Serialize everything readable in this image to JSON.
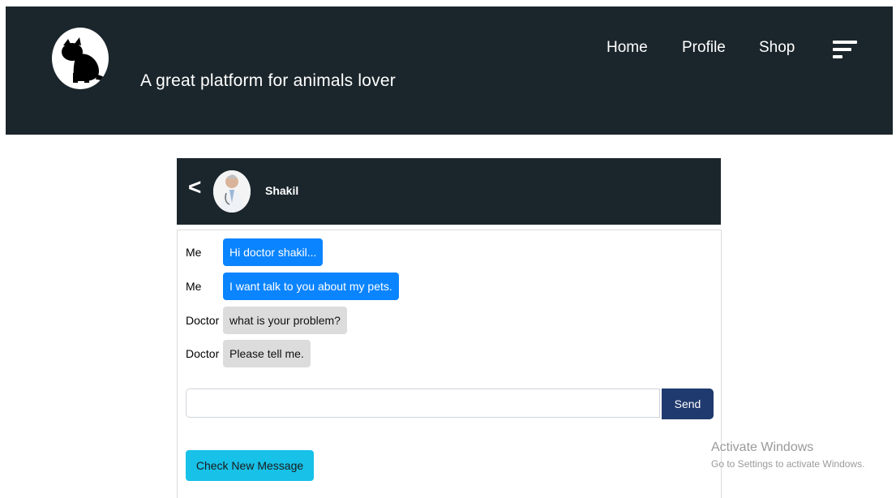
{
  "header": {
    "tagline": "A great platform for animals lover",
    "nav": [
      {
        "label": "Home"
      },
      {
        "label": "Profile"
      },
      {
        "label": "Shop"
      }
    ]
  },
  "chat": {
    "back": "<",
    "contact_name": "Shakil",
    "messages": [
      {
        "sender": "Me",
        "text": "Hi doctor shakil...",
        "type": "me"
      },
      {
        "sender": "Me",
        "text": "I want talk to you about my pets.",
        "type": "me"
      },
      {
        "sender": "Doctor",
        "text": "what is your problem?",
        "type": "doctor"
      },
      {
        "sender": "Doctor",
        "text": "Please tell me.",
        "type": "doctor"
      }
    ],
    "input_value": "",
    "send_label": "Send",
    "check_label": "Check New Message"
  },
  "watermark": {
    "title": "Activate Windows",
    "subtitle": "Go to Settings to activate Windows."
  },
  "colors": {
    "navbar": "#1b262c",
    "me_bubble": "#0a84ff",
    "doctor_bubble": "#dcdcdc",
    "send_button": "#1f3a6e",
    "check_button": "#17c1e8"
  },
  "icons": {
    "logo": "cat-logo-icon",
    "menu": "menu-icon",
    "avatar": "doctor-avatar"
  }
}
